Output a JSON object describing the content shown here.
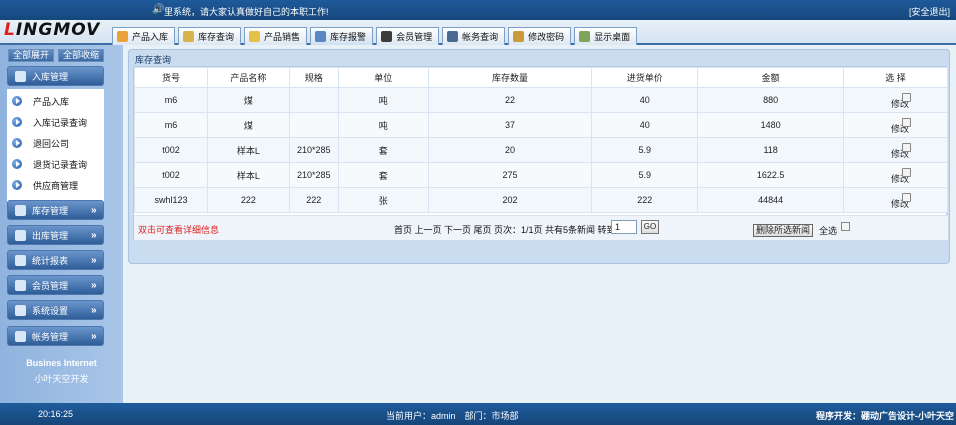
{
  "logo": {
    "part1": "L",
    "part2": "INGMOV"
  },
  "top": {
    "marquee": "里系统，请大家认真做好自己的本职工作!",
    "logout": "[安全退出]"
  },
  "tabs": [
    {
      "label": "产品入库",
      "icon": "house-icon",
      "color": "#e8a23a"
    },
    {
      "label": "库存查询",
      "icon": "book-icon",
      "color": "#d9b44a"
    },
    {
      "label": "产品销售",
      "icon": "tag-icon",
      "color": "#e6c14a"
    },
    {
      "label": "库存报警",
      "icon": "speaker-icon",
      "color": "#5a86c4"
    },
    {
      "label": "会员管理",
      "icon": "member-icon",
      "color": "#3c3c3c"
    },
    {
      "label": "帐务查询",
      "icon": "bag-icon",
      "color": "#4a6a94"
    },
    {
      "label": "修改密码",
      "icon": "key-icon",
      "color": "#c89a3a"
    },
    {
      "label": "显示桌面",
      "icon": "desktop-icon",
      "color": "#7fa35a"
    }
  ],
  "sidebar": {
    "expand_all": "全部展开",
    "collapse_all": "全部收缩",
    "groups": [
      {
        "label": "入库管理",
        "icon": "stock-in-icon"
      },
      {
        "label": "库存管理",
        "icon": "stock-icon"
      },
      {
        "label": "出库管理",
        "icon": "stock-out-icon"
      },
      {
        "label": "统计报表",
        "icon": "report-icon"
      },
      {
        "label": "会员管理",
        "icon": "member-icon"
      },
      {
        "label": "系统设置",
        "icon": "settings-icon"
      },
      {
        "label": "帐务管理",
        "icon": "account-icon"
      }
    ],
    "sub_items": [
      "产品入库",
      "入库记录查询",
      "退回公司",
      "退货记录查询",
      "供应商管理"
    ],
    "footer_title": "Busines Internet",
    "footer_sub": "小叶天空开发"
  },
  "panel": {
    "title": "库存查询",
    "columns": [
      "货号",
      "产品名称",
      "规格",
      "单位",
      "库存数量",
      "进货单价",
      "金额",
      "选 择"
    ],
    "rows": [
      {
        "code": "m6",
        "name": "煤",
        "spec": "",
        "unit": "吨",
        "qty": "22",
        "price": "40",
        "amount": "880",
        "action": "修改"
      },
      {
        "code": "m6",
        "name": "煤",
        "spec": "",
        "unit": "吨",
        "qty": "37",
        "price": "40",
        "amount": "1480",
        "action": "修改"
      },
      {
        "code": "t002",
        "name": "样本L",
        "spec": "210*285",
        "unit": "套",
        "qty": "20",
        "price": "5.9",
        "amount": "118",
        "action": "修改"
      },
      {
        "code": "t002",
        "name": "样本L",
        "spec": "210*285",
        "unit": "套",
        "qty": "275",
        "price": "5.9",
        "amount": "1622.5",
        "action": "修改"
      },
      {
        "code": "swhl123",
        "name": "222",
        "spec": "222",
        "unit": "张",
        "qty": "202",
        "price": "222",
        "amount": "44844",
        "action": "修改"
      }
    ],
    "hint": "双击可查看详细信息",
    "pager_text": "首页 上一页 下一页 尾页 页次：1/1页 共有5条新闻 转到:",
    "page_value": "1",
    "go_label": "GO",
    "delete_label": "删除所选新闻",
    "select_all": "全选"
  },
  "status": {
    "time": "20:16:25",
    "user_label": "当前用户：admin　部门：市场部",
    "credit": "程序开发：硼动广告设计-小叶天空"
  }
}
